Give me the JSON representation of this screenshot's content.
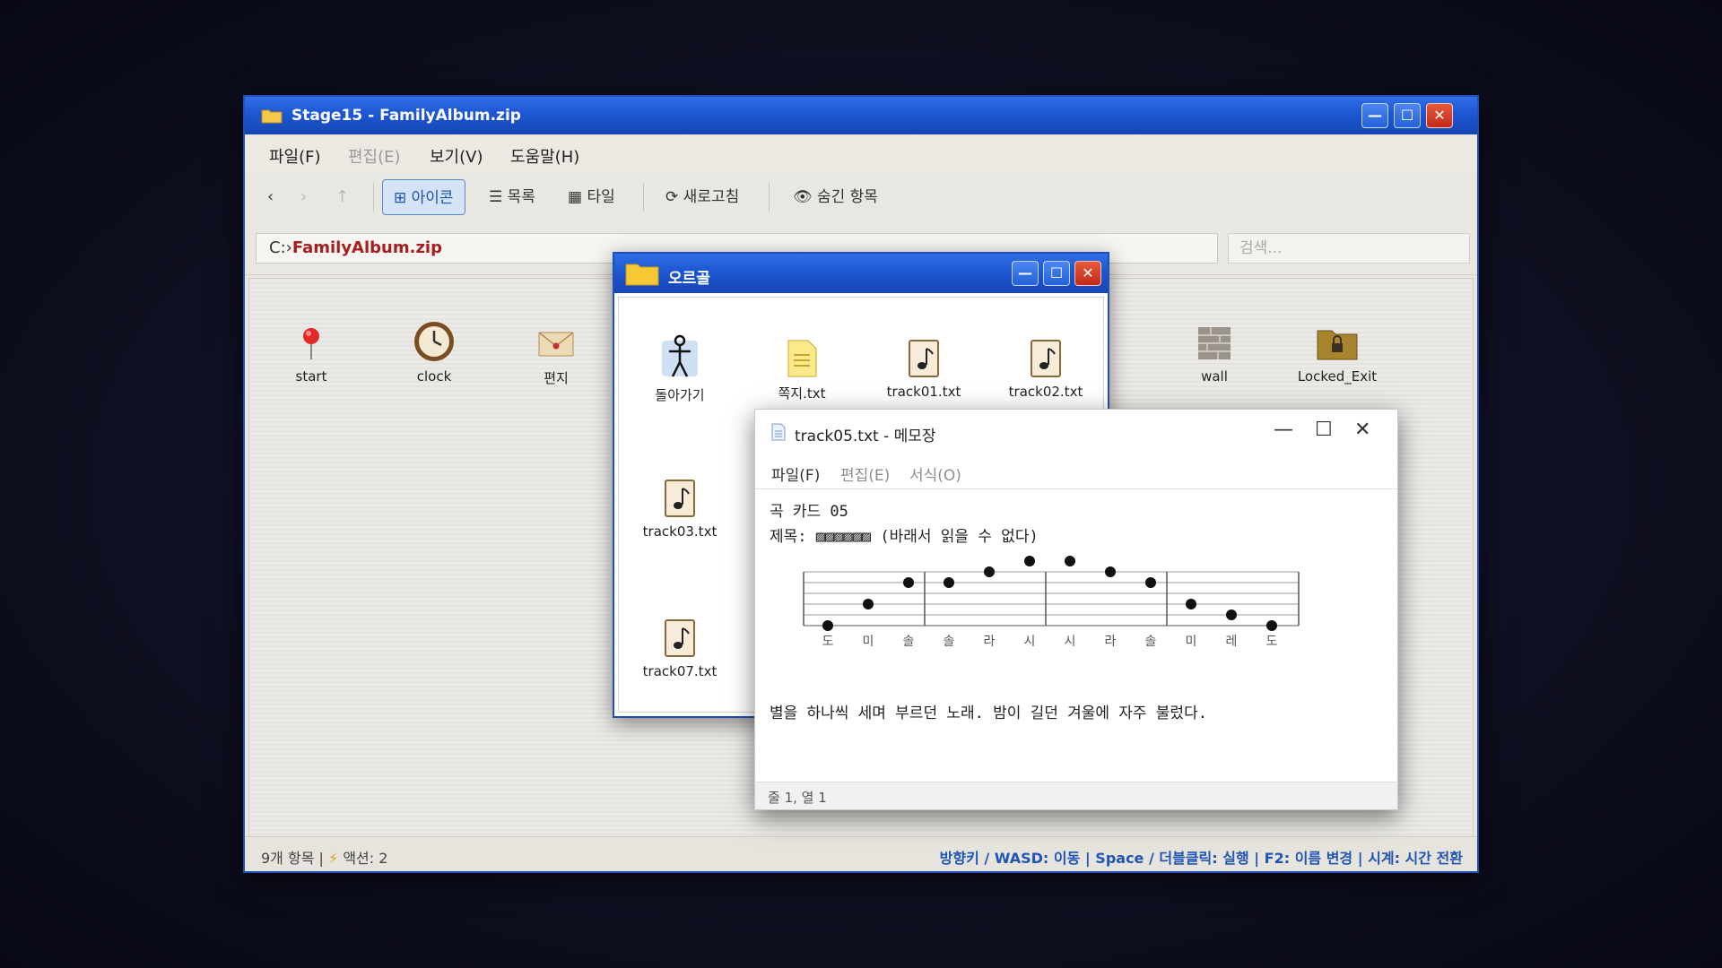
{
  "main_window": {
    "title": "Stage15 - FamilyAlbum.zip",
    "menu": [
      "파일(F)",
      "편집(E)",
      "보기(V)",
      "도움말(H)"
    ],
    "toolbar": {
      "back": "‹",
      "forward": "›",
      "up": "↑",
      "icons_view": "⊞ 아이콘",
      "list_view": "☰ 목록",
      "tile_view": "▦ 타일",
      "refresh": "⟳ 새로고침",
      "hidden": "👁 숨긴 항목"
    },
    "address_prefix": "C:›",
    "address_path": "FamilyAlbum.zip",
    "search_placeholder": "검색...",
    "items": [
      {
        "label": "start",
        "icon": "pin-icon"
      },
      {
        "label": "clock",
        "icon": "clock-icon"
      },
      {
        "label": "편지",
        "icon": "letter-icon"
      },
      {
        "label": "wall",
        "icon": "wall-icon"
      },
      {
        "label": "Locked_Exit",
        "icon": "locked-folder-icon"
      }
    ],
    "status_left_count": "9개 항목 |",
    "status_left_action": "액션: 2",
    "status_right": "방향키 / WASD: 이동 | Space / 더블클릭: 실행 | F2: 이름 변경 | 시계: 시간 전환"
  },
  "folder_window": {
    "title": "오르골",
    "items": [
      {
        "label": "돌아가기",
        "icon": "back-figure-icon"
      },
      {
        "label": "쪽지.txt",
        "icon": "note-file-icon"
      },
      {
        "label": "track01.txt",
        "icon": "music-file-icon"
      },
      {
        "label": "track02.txt",
        "icon": "music-file-icon"
      },
      {
        "label": "track03.txt",
        "icon": "music-file-icon"
      },
      {
        "label": "track07.txt",
        "icon": "music-file-icon"
      }
    ]
  },
  "notepad": {
    "title": "track05.txt - 메모장",
    "menu": [
      "파일(F)",
      "편집(E)",
      "서식(O)"
    ],
    "line1": "곡 카드 05",
    "line2": "제목: ▨▨▨▨▨▨ (바래서 읽을 수 없다)",
    "line3": "별을 하나씩 세며 부르던 노래. 밤이 길던 겨울에 자주 불렀다.",
    "status": "줄 1, 열 1",
    "staff_notes": [
      {
        "name": "도",
        "step": 0
      },
      {
        "name": "미",
        "step": 2
      },
      {
        "name": "솔",
        "step": 4
      },
      {
        "name": "솔",
        "step": 4
      },
      {
        "name": "라",
        "step": 5
      },
      {
        "name": "시",
        "step": 6
      },
      {
        "name": "시",
        "step": 6
      },
      {
        "name": "라",
        "step": 5
      },
      {
        "name": "솔",
        "step": 4
      },
      {
        "name": "미",
        "step": 2
      },
      {
        "name": "레",
        "step": 1
      },
      {
        "name": "도",
        "step": 0
      }
    ]
  }
}
